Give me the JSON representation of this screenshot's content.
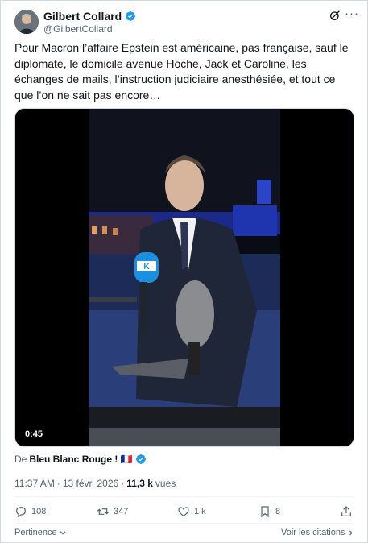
{
  "author": {
    "name": "Gilbert Collard",
    "handle": "@GilbertCollard",
    "verified": true,
    "avatar_icon": "profile-photo"
  },
  "header_icons": [
    "grok-icon",
    "more-icon"
  ],
  "tweet": {
    "text": "Pour Macron l’affaire Epstein est américaine, pas française, sauf le diplomate, le domicile avenue Hoche, Jack et Caroline, les échanges de mails, l’instruction judiciaire anesthésiée, et tout ce que l’on ne sait pas encore…"
  },
  "media": {
    "type": "video",
    "duration": "0:45",
    "mic_logo_text": "K"
  },
  "from": {
    "prefix": "De",
    "source": "Bleu Blanc Rouge ! 🇫🇷",
    "verified": true
  },
  "meta": {
    "time": "11:37 AM",
    "separator": "·",
    "date": "13 févr. 2026",
    "views_count": "11,3 k",
    "views_label": "vues"
  },
  "actions": {
    "replies": "108",
    "reposts": "347",
    "likes": "1 k",
    "bookmarks": "8"
  },
  "footer": {
    "relevance": "Pertinence",
    "quotes": "Voir les citations"
  },
  "colors": {
    "text": "#0f1419",
    "secondary": "#536471",
    "verified": "#1d9bf0",
    "border": "#cfd9de"
  }
}
